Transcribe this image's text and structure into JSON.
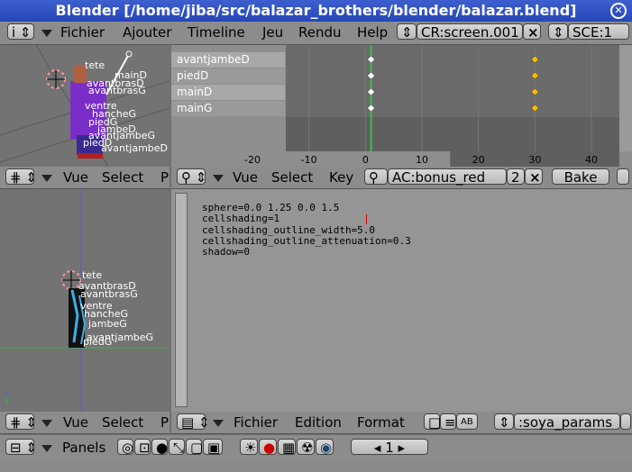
{
  "window": {
    "title": "Blender [/home/jiba/src/balazar_brothers/blender/balazar.blend]"
  },
  "menubar": {
    "menus": [
      "Fichier",
      "Ajouter",
      "Timeline",
      "Jeu",
      "Rendu",
      "Help"
    ],
    "screen": "CR:screen.001",
    "scene": "SCE:1"
  },
  "viewport_top": {
    "bones": [
      "tete",
      "mainD",
      "avantbrasD",
      "avantbrasG",
      "ventre",
      "hancheG",
      "piedG",
      "jambeD",
      "avantjambeG",
      "piedD",
      "avantjambeD"
    ]
  },
  "action_editor": {
    "channels": [
      "avantjambeD",
      "piedD",
      "mainD",
      "mainG"
    ],
    "x_axis": [
      "-20",
      "-10",
      "0",
      "10",
      "20",
      "30",
      "40"
    ],
    "keyframes_frames": [
      1,
      30
    ],
    "current_frame": 1,
    "menus": [
      "Vue",
      "Select",
      "Key"
    ],
    "action": "AC:bonus_red",
    "users": "2",
    "bake": "Bake"
  },
  "viewport_top_header": {
    "menus": [
      "Vue",
      "Select",
      "P"
    ]
  },
  "viewport_bottom": {
    "bones": [
      "tete",
      "avantbrasD",
      "avantbrasG",
      "ventre",
      "hancheG",
      "jambeG",
      "avantjambeG",
      "piedG"
    ],
    "axis_label": "z y"
  },
  "viewport_bottom_header": {
    "menus": [
      "Vue",
      "Select",
      "P"
    ]
  },
  "text_editor": {
    "lines": [
      "sphere=0.0 1.25 0.0 1.5",
      "cellshading=1",
      "cellshading_outline_width=5.0",
      "cellshading_outline_attenuation=0.3",
      "shadow=0"
    ],
    "menus": [
      "Fichier",
      "Edition",
      "Format"
    ],
    "text_name": ":soya_params"
  },
  "buttons_header": {
    "label": "Panels",
    "frame": "1"
  },
  "colors": {
    "titlebar": "#2a4bbf",
    "header": "#8c8c8c",
    "viewport": "#737373",
    "keyframe": "#f0c000",
    "cursor_line": "#3fbf3f"
  }
}
